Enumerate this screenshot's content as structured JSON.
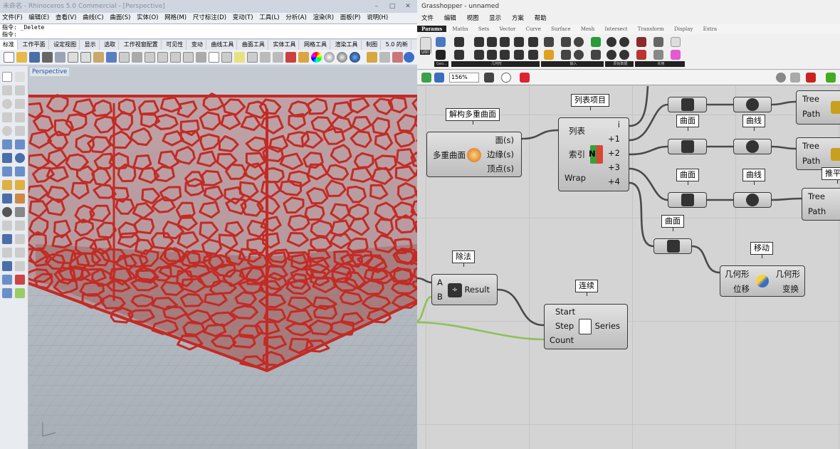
{
  "rhino": {
    "title": "未命名 - Rhinoceros 5.0 Commercial - [Perspective]",
    "menu": [
      "文件(F)",
      "编辑(E)",
      "查看(V)",
      "曲线(C)",
      "曲面(S)",
      "实体(O)",
      "网格(M)",
      "尺寸标注(D)",
      "变动(T)",
      "工具(L)",
      "分析(A)",
      "渲染(R)",
      "面板(P)",
      "说明(H)"
    ],
    "cmd_line1": "指令: _Delete",
    "cmd_line2": "指令:",
    "toolbar_tabs": [
      "标准",
      "工作平面",
      "设定视图",
      "显示",
      "选取",
      "工作视窗配置",
      "可见性",
      "变动",
      "曲线工具",
      "曲面工具",
      "实体工具",
      "网格工具",
      "渲染工具",
      "制图",
      "5.0 的新"
    ],
    "viewport_label": "Perspective",
    "colors": {
      "mesh": "#c42a24",
      "viewport_bg": "#bcc2ca"
    }
  },
  "gh": {
    "title": "Grasshopper - unnamed",
    "menu": [
      "文件",
      "编辑",
      "视图",
      "显示",
      "方案",
      "帮助"
    ],
    "tabs": [
      "Params",
      "Maths",
      "Sets",
      "Vector",
      "Curve",
      "Surface",
      "Mesh",
      "Intersect",
      "Transform",
      "Display",
      "Extra"
    ],
    "active_tab": "Params",
    "ribbon_groups": [
      "Geo...",
      "几何形",
      "输入",
      "原始数据",
      "实用"
    ],
    "util_label": "Util",
    "zoom": "156%",
    "components": {
      "deconstruct": {
        "tag": "解构多重曲面",
        "input": "多重曲面",
        "outputs": [
          "面(s)",
          "边缘(s)",
          "顶点(s)"
        ]
      },
      "list_item": {
        "tag": "列表项目",
        "inputs": [
          "列表",
          "索引",
          "Wrap"
        ],
        "outputs": [
          "i",
          "+1",
          "+2",
          "+3",
          "+4"
        ],
        "icon_letter": "N"
      },
      "surface_tags": [
        "曲面",
        "曲面",
        "曲面",
        "曲面"
      ],
      "curve_tags": [
        "曲线",
        "曲线",
        "曲线"
      ],
      "tree_labels": [
        "Tree",
        "Path"
      ],
      "tree_partial_tag": "推平设",
      "move": {
        "tag": "移动",
        "inputs": [
          "几何形",
          "位移"
        ],
        "outputs": [
          "几何形",
          "变换"
        ]
      },
      "division": {
        "tag": "除法",
        "inputs": [
          "A",
          "B"
        ],
        "output": "Result"
      },
      "series": {
        "tag": "连续",
        "inputs": [
          "Start",
          "Step",
          "Count"
        ],
        "output": "Series"
      }
    },
    "colors": {
      "wire": "#4a4a4a",
      "wire_green": "#8fc05a",
      "canvas": "#d4d4d4"
    }
  }
}
